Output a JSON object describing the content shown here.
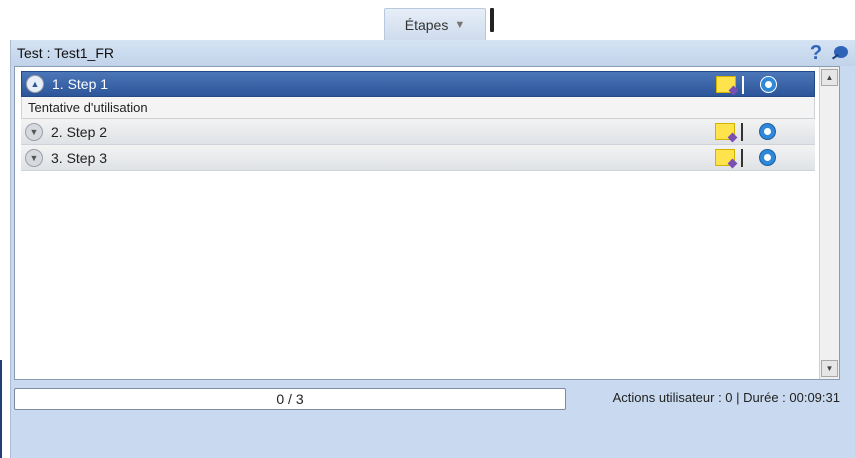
{
  "tab": {
    "label": "Étapes",
    "caret": "▼"
  },
  "panel": {
    "title": "Test : Test1_FR",
    "help_glyph": "?",
    "accent_color": "#2c5699"
  },
  "toolbar": {
    "icons": [
      "pass-icon",
      "fail-icon",
      "add-comment-icon",
      "edit-icon",
      "report-icon",
      "attachment-icon",
      "screen-icon",
      "tree-view-icon",
      "sort-asc-icon",
      "sort-desc-icon",
      "parameters-icon",
      "search-icon"
    ]
  },
  "steps": [
    {
      "label": "1. Step 1",
      "detail": "Tentative d'utilisation",
      "selected": true
    },
    {
      "label": "2. Step 2",
      "selected": false
    },
    {
      "label": "3. Step 3",
      "selected": false
    }
  ],
  "status": {
    "progress_text": "0 / 3",
    "progress_value": 0,
    "info": "Actions utilisateur : 0 | Durée : 00:09:31"
  }
}
